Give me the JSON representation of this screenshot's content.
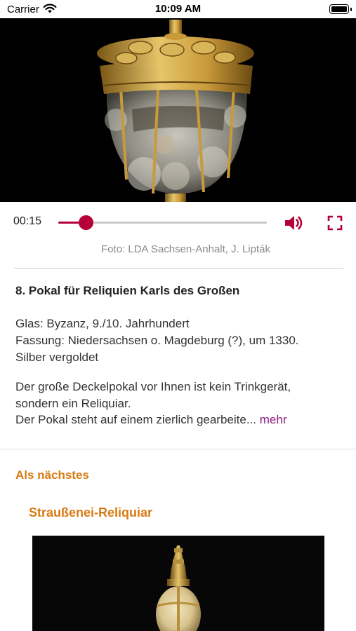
{
  "status_bar": {
    "carrier": "Carrier",
    "time": "10:09 AM"
  },
  "player": {
    "elapsed": "00:15",
    "progress_fraction": 0.13,
    "accent_color": "#b5003a"
  },
  "photo_credit": "Foto: LDA Sachsen-Anhalt, J. Lipták",
  "exhibit": {
    "title": "8. Pokal für Reliquien Karls des Großen",
    "meta_lines": [
      "Glas: Byzanz, 9./10. Jahrhundert",
      "Fassung: Niedersachsen o. Magdeburg (?), um 1330.",
      "Silber vergoldet"
    ],
    "description_lines": [
      "Der große Deckelpokal vor Ihnen ist kein Trinkgerät,",
      "sondern ein Reliquiar.",
      "Der Pokal steht auf einem zierlich gearbeite..."
    ],
    "more_label": "mehr"
  },
  "next": {
    "heading": "Als nächstes",
    "title": "Straußenei-Reliquiar"
  },
  "colors": {
    "orange": "#d97a12",
    "link_purple": "#8a1d7e"
  },
  "icons": [
    "wifi-icon",
    "battery-icon",
    "volume-icon",
    "fullscreen-icon"
  ]
}
